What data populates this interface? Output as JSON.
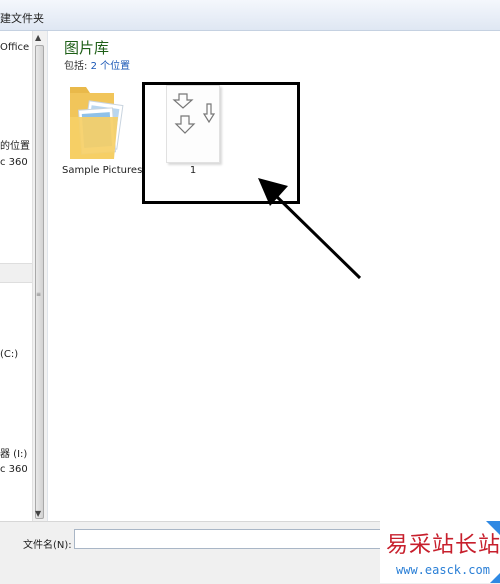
{
  "window": {
    "title_fragment": "建文件夹"
  },
  "nav": {
    "items": [
      {
        "label": "Office"
      },
      {
        "label": "的位置"
      },
      {
        "label": "c 360"
      },
      {
        "label": "(C:)"
      },
      {
        "label": "器 (I:)"
      },
      {
        "label": "c 360"
      }
    ]
  },
  "library": {
    "title": "图片库",
    "includes_prefix": "包括:",
    "includes_link": "2 个位置"
  },
  "items": {
    "folder_caption": "Sample Pictures",
    "file_caption": "1"
  },
  "bottom": {
    "filename_label": "文件名(N):",
    "filename_value": ""
  },
  "watermark": {
    "chinese": "易采站长站",
    "url": "www.easck.com"
  },
  "colors": {
    "library_title": "#1e5f17",
    "link": "#1a57b6",
    "highlight_box": "#000000",
    "watermark_red": "#c71f2c",
    "watermark_blue": "#2a7fd6"
  }
}
